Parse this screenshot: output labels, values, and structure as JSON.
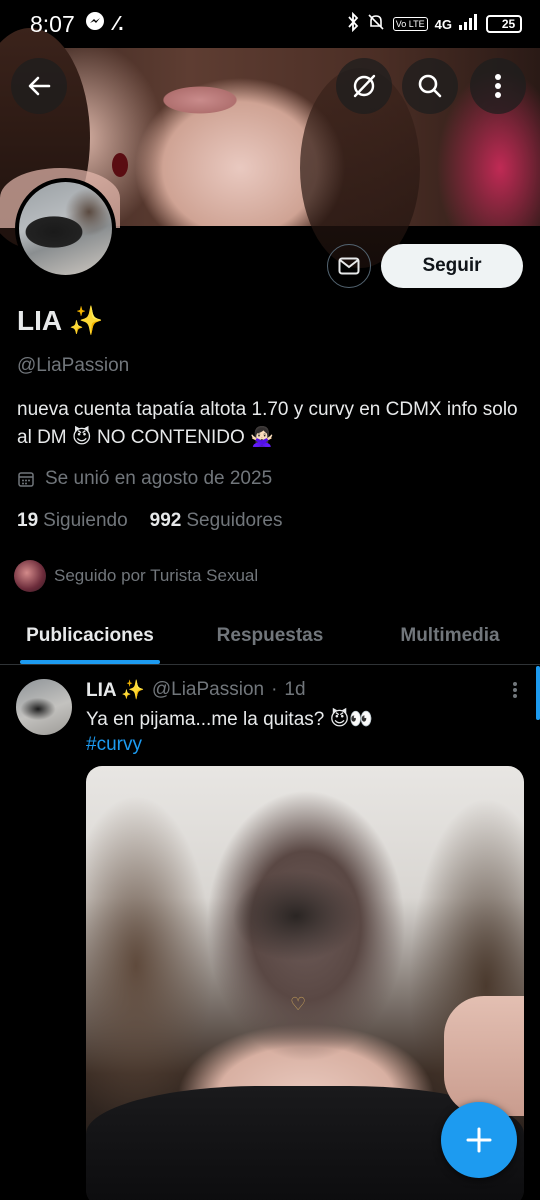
{
  "status_bar": {
    "time": "8:07",
    "network": "4G",
    "volte": "Vo LTE",
    "battery": "25",
    "battery_color": "#f2c230"
  },
  "header": {
    "back_icon": "arrow-left-icon",
    "grok_icon": "grok-icon",
    "search_icon": "search-icon",
    "more_icon": "more-vertical-icon"
  },
  "profile": {
    "name": "LIA ✨",
    "handle": "@LiaPassion",
    "bio": "nueva cuenta tapatía altota 1.70 y curvy en CDMX info solo al DM 😈 NO CONTENIDO 🙅🏻‍♀️",
    "joined": "Se unió en agosto de 2025",
    "following_count": "19",
    "following_label": "Siguiendo",
    "followers_count": "992",
    "followers_label": "Seguidores",
    "followed_by": "Seguido por Turista Sexual",
    "follow_button": "Seguir"
  },
  "tabs": [
    {
      "label": "Publicaciones",
      "active": true
    },
    {
      "label": "Respuestas",
      "active": false
    },
    {
      "label": "Multimedia",
      "active": false
    }
  ],
  "tweet": {
    "name": "LIA ✨",
    "handle": "@LiaPassion",
    "separator": "·",
    "time": "1d",
    "text": "Ya en pijama...me la quitas? 😈👀",
    "hashtag": "#curvy"
  },
  "colors": {
    "accent": "#1d9bf0",
    "background": "#000000",
    "secondary_text": "#71767b"
  }
}
